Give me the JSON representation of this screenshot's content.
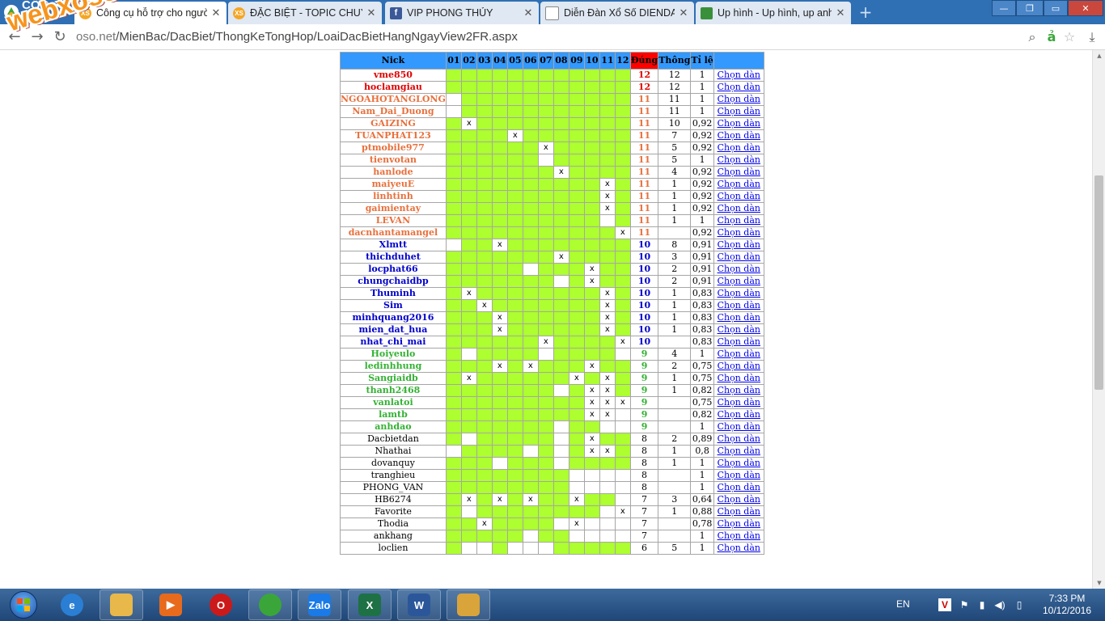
{
  "browser": {
    "brand": "CỐC CỐC",
    "tabs": [
      {
        "title": "Công cụ hỗ trợ cho người",
        "icon": "XS",
        "color": "#f5a623",
        "active": true
      },
      {
        "title": "ĐẶC BIỆT - TOPIC CHUYÊN",
        "icon": "XS",
        "color": "#f5a623",
        "active": false
      },
      {
        "title": "VIP PHONG THỦY",
        "icon": "f",
        "color": "#3b5998",
        "active": false
      },
      {
        "title": "Diễn Đàn Xổ Số DIENDAN",
        "icon": "doc",
        "color": "#888888",
        "active": false
      },
      {
        "title": "Up hình - Up hình, up anh",
        "icon": "img",
        "color": "#3a8f3a",
        "active": false
      }
    ],
    "url_host": "oso.net",
    "url_path": "/MienBac/DacBiet/ThongKeTongHop/LoaiDacBietHangNgayView2FR.aspx"
  },
  "watermark": "webxoso.net",
  "table": {
    "headers": {
      "nick": "Nick",
      "days": [
        "01",
        "02",
        "03",
        "04",
        "05",
        "06",
        "07",
        "08",
        "09",
        "10",
        "11",
        "12"
      ],
      "dung": "Đúng",
      "thong": "Thông",
      "tile": "Tỉ lệ"
    },
    "link_label": "Chọn dàn",
    "rows": [
      {
        "nick": "vme850",
        "tier": "red",
        "cells": "gggggggggggg",
        "dung": "12",
        "thong": "12",
        "tile": "1"
      },
      {
        "nick": "hoclamgiau",
        "tier": "red",
        "cells": "gggggggggggg",
        "dung": "12",
        "thong": "12",
        "tile": "1"
      },
      {
        "nick": "NGOAHOTANGLONG",
        "tier": "orange",
        "cells": "-ggggggggggg",
        "dung": "11",
        "thong": "11",
        "tile": "1"
      },
      {
        "nick": "Nam_Dai_Duong",
        "tier": "orange",
        "cells": "-ggggggggggg",
        "dung": "11",
        "thong": "11",
        "tile": "1"
      },
      {
        "nick": "GAIZING",
        "tier": "orange",
        "cells": "gxgggggggggg",
        "dung": "11",
        "thong": "10",
        "tile": "0,92"
      },
      {
        "nick": "TUANPHAT123",
        "tier": "orange",
        "cells": "ggggxggggggg",
        "dung": "11",
        "thong": "7",
        "tile": "0,92"
      },
      {
        "nick": "ptmobile977",
        "tier": "orange",
        "cells": "ggggggxggggg",
        "dung": "11",
        "thong": "5",
        "tile": "0,92"
      },
      {
        "nick": "tienvotan",
        "tier": "orange",
        "cells": "gggggg-ggggg",
        "dung": "11",
        "thong": "5",
        "tile": "1"
      },
      {
        "nick": "hanlode",
        "tier": "orange",
        "cells": "gggggggxgggg",
        "dung": "11",
        "thong": "4",
        "tile": "0,92"
      },
      {
        "nick": "maiyeuE",
        "tier": "orange",
        "cells": "ggggggggggxg",
        "dung": "11",
        "thong": "1",
        "tile": "0,92"
      },
      {
        "nick": "linhtinh",
        "tier": "orange",
        "cells": "ggggggggggxg",
        "dung": "11",
        "thong": "1",
        "tile": "0,92"
      },
      {
        "nick": "gaimientay",
        "tier": "orange",
        "cells": "ggggggggggxg",
        "dung": "11",
        "thong": "1",
        "tile": "0,92"
      },
      {
        "nick": "LEVAN",
        "tier": "orange",
        "cells": "gggggggggg-g",
        "dung": "11",
        "thong": "1",
        "tile": "1"
      },
      {
        "nick": "dacnhantamangel",
        "tier": "orange",
        "cells": "gggggggggggx",
        "dung": "11",
        "thong": "",
        "tile": "0,92"
      },
      {
        "nick": "Xlmtt",
        "tier": "blue",
        "cells": "-ggxgggggggg",
        "dung": "10",
        "thong": "8",
        "tile": "0,91"
      },
      {
        "nick": "thichduhet",
        "tier": "blue",
        "cells": "gggggggxgggg",
        "dung": "10",
        "thong": "3",
        "tile": "0,91"
      },
      {
        "nick": "locphat66",
        "tier": "blue",
        "cells": "ggggg-gggxgg",
        "dung": "10",
        "thong": "2",
        "tile": "0,91"
      },
      {
        "nick": "chungchaidbp",
        "tier": "blue",
        "cells": "ggggggg-gxgg",
        "dung": "10",
        "thong": "2",
        "tile": "0,91"
      },
      {
        "nick": "Thuminh",
        "tier": "blue",
        "cells": "gxggggggggxg",
        "dung": "10",
        "thong": "1",
        "tile": "0,83"
      },
      {
        "nick": "Sim",
        "tier": "blue",
        "cells": "ggxgggggggxg",
        "dung": "10",
        "thong": "1",
        "tile": "0,83"
      },
      {
        "nick": "minhquang2016",
        "tier": "blue",
        "cells": "gggxggggggxg",
        "dung": "10",
        "thong": "1",
        "tile": "0,83"
      },
      {
        "nick": "mien_dat_hua",
        "tier": "blue",
        "cells": "gggxggggggxg",
        "dung": "10",
        "thong": "1",
        "tile": "0,83"
      },
      {
        "nick": "nhat_chi_mai",
        "tier": "blue",
        "cells": "ggggggxggggx",
        "dung": "10",
        "thong": "",
        "tile": "0,83"
      },
      {
        "nick": "Hoiyeulo",
        "tier": "green",
        "cells": "g-gggg-gggg-",
        "dung": "9",
        "thong": "4",
        "tile": "1"
      },
      {
        "nick": "ledinhhung",
        "tier": "green",
        "cells": "gggxgxgggxgg",
        "dung": "9",
        "thong": "2",
        "tile": "0,75"
      },
      {
        "nick": "Sangiaidb",
        "tier": "green",
        "cells": "gxggggggxgxg",
        "dung": "9",
        "thong": "1",
        "tile": "0,75"
      },
      {
        "nick": "thanh2468",
        "tier": "green",
        "cells": "ggggggg-gxxg",
        "dung": "9",
        "thong": "1",
        "tile": "0,82"
      },
      {
        "nick": "vanlatoi",
        "tier": "green",
        "cells": "gggggggggxxx",
        "dung": "9",
        "thong": "",
        "tile": "0,75"
      },
      {
        "nick": "lamtb",
        "tier": "green",
        "cells": "gggggggggxx-",
        "dung": "9",
        "thong": "",
        "tile": "0,82"
      },
      {
        "nick": "anhdao",
        "tier": "green",
        "cells": "ggggggg-gg--",
        "dung": "9",
        "thong": "",
        "tile": "1"
      },
      {
        "nick": "Dacbietdan",
        "tier": "black",
        "cells": "g-ggggg-gxgg",
        "dung": "8",
        "thong": "2",
        "tile": "0,89"
      },
      {
        "nick": "Nhathai",
        "tier": "black",
        "cells": "-gggg-g-gxxg",
        "dung": "8",
        "thong": "1",
        "tile": "0,8"
      },
      {
        "nick": "dovanquy",
        "tier": "black",
        "cells": "ggg-ggg-gggg",
        "dung": "8",
        "thong": "1",
        "tile": "1"
      },
      {
        "nick": "tranghieu",
        "tier": "black",
        "cells": "gggggggg----",
        "dung": "8",
        "thong": "",
        "tile": "1"
      },
      {
        "nick": "PHONG_VAN",
        "tier": "black",
        "cells": "gggggggg----",
        "dung": "8",
        "thong": "",
        "tile": "1"
      },
      {
        "nick": "HB6274",
        "tier": "black",
        "cells": "gxgxgxggxgg-",
        "dung": "7",
        "thong": "3",
        "tile": "0,64"
      },
      {
        "nick": "Favorite",
        "tier": "black",
        "cells": "g-gggggggg-x",
        "dung": "7",
        "thong": "1",
        "tile": "0,88"
      },
      {
        "nick": "Thodia",
        "tier": "black",
        "cells": "ggxgggg-x---",
        "dung": "7",
        "thong": "",
        "tile": "0,78"
      },
      {
        "nick": "ankhang",
        "tier": "black",
        "cells": "ggggg-gg----",
        "dung": "7",
        "thong": "",
        "tile": "1"
      },
      {
        "nick": "loclien",
        "tier": "black",
        "cells": "g--g---ggggg",
        "dung": "6",
        "thong": "5",
        "tile": "1"
      }
    ]
  },
  "taskbar": {
    "apps": [
      {
        "name": "ie",
        "label": "e",
        "color": "#2a7fd4"
      },
      {
        "name": "explorer",
        "label": "",
        "color": "#e8b84a"
      },
      {
        "name": "media",
        "label": "▶",
        "color": "#e86a1c"
      },
      {
        "name": "opera",
        "label": "O",
        "color": "#cc1a1a"
      },
      {
        "name": "coccoc",
        "label": "",
        "color": "#3aa63a"
      },
      {
        "name": "zalo",
        "label": "Zalo",
        "color": "#1a7ae8"
      },
      {
        "name": "excel",
        "label": "X",
        "color": "#1e7145"
      },
      {
        "name": "word",
        "label": "W",
        "color": "#2b579a"
      },
      {
        "name": "paint",
        "label": "",
        "color": "#d9a43a"
      }
    ],
    "lang": "EN",
    "time": "7:33 PM",
    "date": "10/12/2016"
  },
  "colors": {
    "hit": "#adff2f",
    "header": "#3399ff",
    "dung_header": "#ff0000",
    "red": "#e10000",
    "orange": "#e8703c",
    "blue": "#0000cc",
    "green": "#33b233"
  }
}
